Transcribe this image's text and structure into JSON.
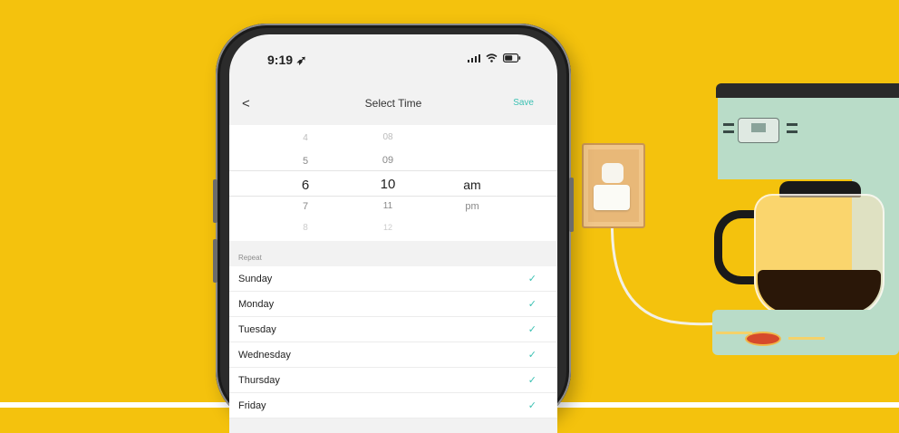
{
  "status_bar": {
    "time": "9:19 ➶"
  },
  "nav": {
    "back": "<",
    "title": "Select Time",
    "save": "Save"
  },
  "picker": {
    "hours": [
      "4",
      "5",
      "6",
      "7",
      "8"
    ],
    "minutes": [
      "08",
      "09",
      "10",
      "11",
      "12"
    ],
    "periods": [
      "am",
      "pm"
    ],
    "selected": {
      "hour": "6",
      "minute": "10",
      "period": "am"
    }
  },
  "repeat": {
    "label": "Repeat",
    "days": [
      {
        "name": "Sunday",
        "checked": true
      },
      {
        "name": "Monday",
        "checked": true
      },
      {
        "name": "Tuesday",
        "checked": true
      },
      {
        "name": "Wednesday",
        "checked": true
      },
      {
        "name": "Thursday",
        "checked": true
      },
      {
        "name": "Friday",
        "checked": true
      }
    ],
    "check_icon": "✓"
  },
  "colors": {
    "accent": "#3cc1b3",
    "background": "#f4c20d",
    "coffee_maker": "#b9dcc8"
  },
  "icons": [
    "back-chevron-icon",
    "signal-icon",
    "wifi-icon",
    "battery-icon",
    "check-icon",
    "location-arrow-icon"
  ]
}
